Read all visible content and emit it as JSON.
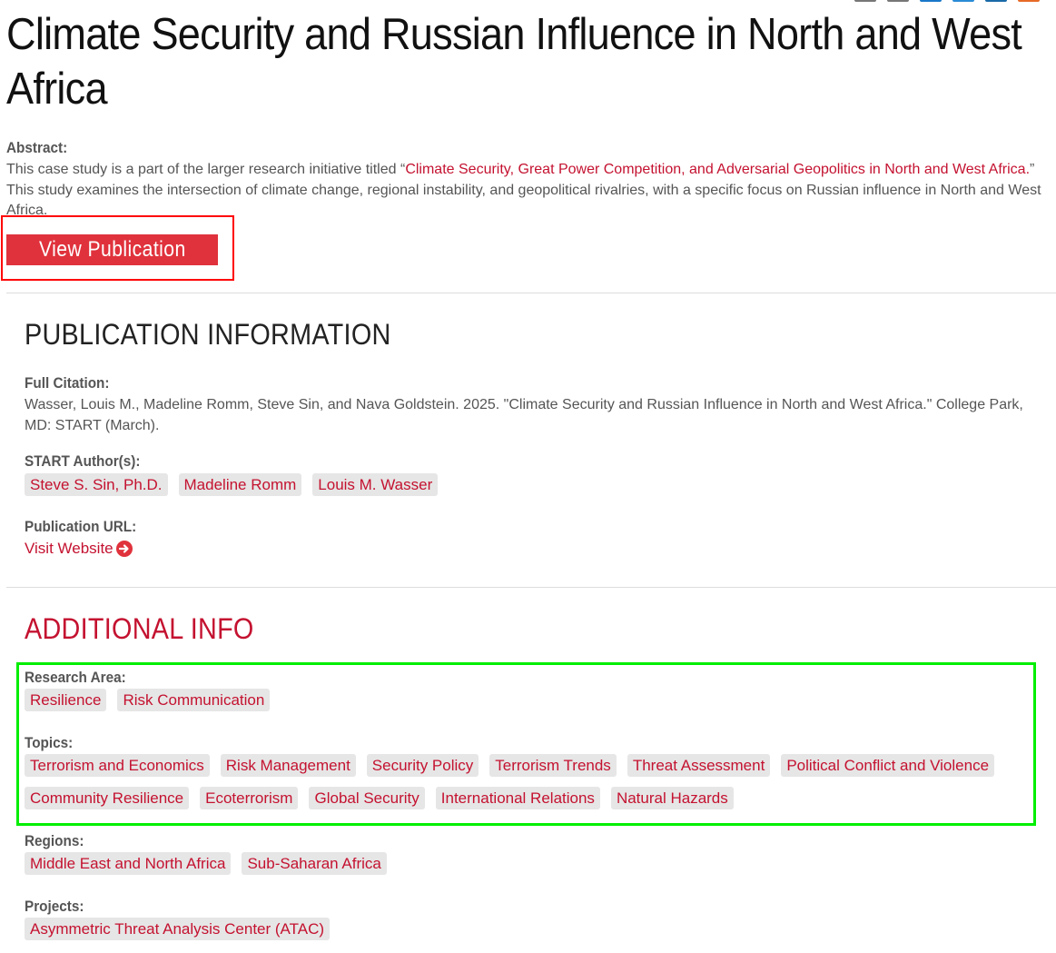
{
  "title": {
    "line1": "Climate Security and Russian Influence in North and West",
    "line2": "Africa"
  },
  "abstract": {
    "label": "Abstract:",
    "text_before": "This case study is a part of the larger research initiative titled “",
    "link_text": "Climate Security, Great Power Competition, and Adversarial Geopolitics in North and West Africa.",
    "text_after": "” This study examines the intersection of climate change, regional instability, and geopolitical rivalries, with a specific focus on Russian influence in North and West Africa."
  },
  "view_publication_label": "View Publication",
  "publication_info": {
    "heading": "PUBLICATION INFORMATION",
    "citation_label": "Full Citation:",
    "citation_text": "Wasser, Louis M., Madeline Romm, Steve Sin, and Nava Goldstein. 2025. \"Climate Security and Russian Influence in North and West Africa.\" College Park, MD: START (March).",
    "authors_label": "START Author(s):",
    "authors": [
      "Steve S. Sin, Ph.D.",
      "Madeline Romm",
      "Louis M. Wasser"
    ],
    "url_label": "Publication URL:",
    "url_link_text": "Visit Website"
  },
  "additional_info": {
    "heading": "ADDITIONAL INFO",
    "research_area_label": "Research Area:",
    "research_areas": [
      "Resilience",
      "Risk Communication"
    ],
    "topics_label": "Topics:",
    "topics_row1": [
      "Terrorism and Economics",
      "Risk Management",
      "Security Policy",
      "Terrorism Trends",
      "Threat Assessment",
      "Political Conflict and Violence"
    ],
    "topics_row2": [
      "Community Resilience",
      "Ecoterrorism",
      "Global Security",
      "International Relations",
      "Natural Hazards"
    ],
    "regions_label": "Regions:",
    "regions": [
      "Middle East and North Africa",
      "Sub-Saharan Africa"
    ],
    "projects_label": "Projects:",
    "projects": [
      "Asymmetric Threat Analysis Center (ATAC)"
    ]
  },
  "colors": {
    "accent_red": "#c41230",
    "button_red": "#e0323c",
    "highlight_red_box": "#ff0000",
    "highlight_green_box": "#00ee00",
    "tag_background": "#e6e6e6"
  },
  "icons": {
    "visit_website": "arrow-circle-right-icon",
    "share": [
      "email-share-icon",
      "print-share-icon",
      "facebook-share-icon",
      "twitter-share-icon",
      "linkedin-share-icon",
      "rss-share-icon"
    ]
  }
}
